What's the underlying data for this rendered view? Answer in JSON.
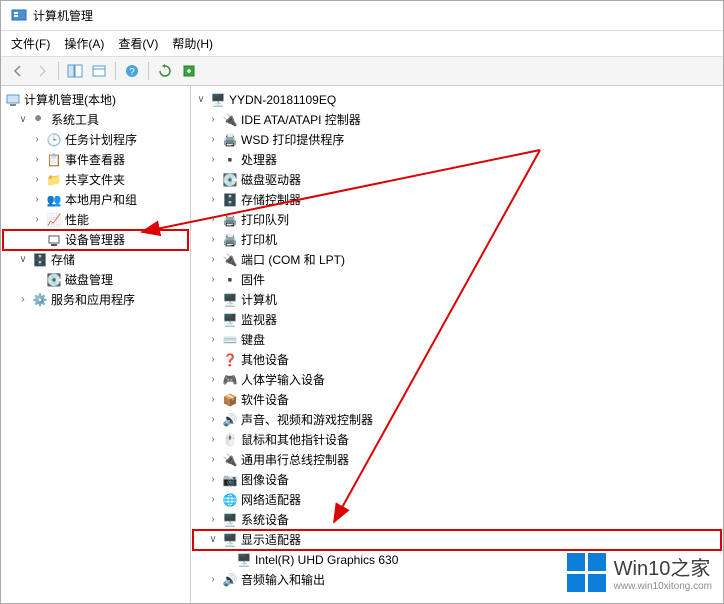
{
  "title": "计算机管理",
  "menus": {
    "file": "文件(F)",
    "action": "操作(A)",
    "view": "查看(V)",
    "help": "帮助(H)"
  },
  "tree_root": "计算机管理(本地)",
  "sys_tools": "系统工具",
  "task_sched": "任务计划程序",
  "event_viewer": "事件查看器",
  "shared_folders": "共享文件夹",
  "local_users": "本地用户和组",
  "performance": "性能",
  "device_mgr": "设备管理器",
  "storage": "存储",
  "disk_mgmt": "磁盘管理",
  "services_apps": "服务和应用程序",
  "pc_name": "YYDN-20181109EQ",
  "dm": {
    "ide": "IDE ATA/ATAPI 控制器",
    "wsd": "WSD 打印提供程序",
    "cpu": "处理器",
    "disk": "磁盘驱动器",
    "storage_ctrl": "存储控制器",
    "print_queue": "打印队列",
    "printer": "打印机",
    "port": "端口 (COM 和 LPT)",
    "firmware": "固件",
    "computer": "计算机",
    "monitor": "监视器",
    "keyboard": "键盘",
    "other": "其他设备",
    "hid": "人体学输入设备",
    "software": "软件设备",
    "sound": "声音、视频和游戏控制器",
    "mouse": "鼠标和其他指针设备",
    "usb": "通用串行总线控制器",
    "imaging": "图像设备",
    "network": "网络适配器",
    "system": "系统设备",
    "display": "显示适配器",
    "display_child": "Intel(R) UHD Graphics 630",
    "audio_io": "音频输入和输出"
  },
  "watermark": {
    "title": "Win10之家",
    "url": "www.win10xitong.com"
  }
}
